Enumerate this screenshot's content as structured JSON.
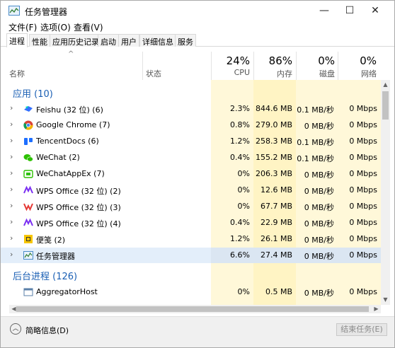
{
  "window": {
    "title": "任务管理器",
    "controls": {
      "minimize": "—",
      "maximize": "☐",
      "close": "✕"
    }
  },
  "menu": [
    "文件(F)",
    "选项(O)",
    "查看(V)"
  ],
  "tabs": [
    {
      "label": "进程",
      "active": true
    },
    {
      "label": "性能",
      "active": false
    },
    {
      "label": "应用历史记录",
      "active": false
    },
    {
      "label": "启动",
      "active": false
    },
    {
      "label": "用户",
      "active": false
    },
    {
      "label": "详细信息",
      "active": false
    },
    {
      "label": "服务",
      "active": false
    }
  ],
  "header": {
    "sort_caret": "^",
    "name": "名称",
    "status": "状态",
    "cpu": {
      "percent": "24%",
      "label": "CPU"
    },
    "memory": {
      "percent": "86%",
      "label": "内存"
    },
    "disk": {
      "percent": "0%",
      "label": "磁盘"
    },
    "network": {
      "percent": "0%",
      "label": "网络"
    }
  },
  "groups": [
    {
      "title": "应用 (10)",
      "rows": [
        {
          "name": "Feishu (32 位) (6)",
          "icon": "feishu-icon",
          "cpu": "2.3%",
          "memory": "844.6 MB",
          "disk": "0.1 MB/秒",
          "network": "0 Mbps",
          "expandable": true
        },
        {
          "name": "Google Chrome (7)",
          "icon": "chrome-icon",
          "cpu": "0.8%",
          "memory": "279.0 MB",
          "disk": "0 MB/秒",
          "network": "0 Mbps",
          "expandable": true
        },
        {
          "name": "TencentDocs (6)",
          "icon": "tencent-docs-icon",
          "cpu": "1.2%",
          "memory": "258.3 MB",
          "disk": "0.1 MB/秒",
          "network": "0 Mbps",
          "expandable": true
        },
        {
          "name": "WeChat (2)",
          "icon": "wechat-icon",
          "cpu": "0.4%",
          "memory": "155.2 MB",
          "disk": "0.1 MB/秒",
          "network": "0 Mbps",
          "expandable": true
        },
        {
          "name": "WeChatAppEx (7)",
          "icon": "wechat-appex-icon",
          "cpu": "0%",
          "memory": "206.3 MB",
          "disk": "0 MB/秒",
          "network": "0 Mbps",
          "expandable": true
        },
        {
          "name": "WPS Office (32 位) (2)",
          "icon": "wps-icon",
          "cpu": "0%",
          "memory": "12.6 MB",
          "disk": "0 MB/秒",
          "network": "0 Mbps",
          "expandable": true
        },
        {
          "name": "WPS Office (32 位) (3)",
          "icon": "wps-writer-icon",
          "cpu": "0%",
          "memory": "67.7 MB",
          "disk": "0 MB/秒",
          "network": "0 Mbps",
          "expandable": true
        },
        {
          "name": "WPS Office (32 位) (4)",
          "icon": "wps-icon",
          "cpu": "0.4%",
          "memory": "22.9 MB",
          "disk": "0 MB/秒",
          "network": "0 Mbps",
          "expandable": true
        },
        {
          "name": "便笺 (2)",
          "icon": "sticky-notes-icon",
          "cpu": "1.2%",
          "memory": "26.1 MB",
          "disk": "0 MB/秒",
          "network": "0 Mbps",
          "expandable": true
        },
        {
          "name": "任务管理器",
          "icon": "task-manager-icon",
          "cpu": "6.6%",
          "memory": "27.4 MB",
          "disk": "0 MB/秒",
          "network": "0 Mbps",
          "expandable": true,
          "selected": true
        }
      ]
    },
    {
      "title": "后台进程 (126)",
      "rows": [
        {
          "name": "AggregatorHost",
          "icon": "process-icon",
          "cpu": "0%",
          "memory": "0.5 MB",
          "disk": "0 MB/秒",
          "network": "0 Mbps",
          "expandable": false
        }
      ]
    }
  ],
  "footer": {
    "fewer_details": "简略信息(D)",
    "end_task": "结束任务(E)"
  },
  "colors": {
    "accent_group": "#1a5fb4",
    "metric_bg": "#fff4c4",
    "selected_row": "#e3eefa"
  }
}
